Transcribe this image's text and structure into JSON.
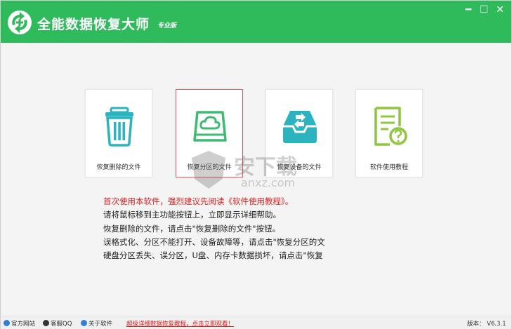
{
  "window": {
    "title": "全能数据恢复大师",
    "edition": "专业版",
    "controls": {
      "minimize": "━",
      "maximize": "☐",
      "close": "✕"
    }
  },
  "cards": [
    {
      "label": "恢复删除的文件",
      "icon": "trash-can-icon",
      "selected": false
    },
    {
      "label": "恢复分区的文件",
      "icon": "drive-cloud-icon",
      "selected": true
    },
    {
      "label": "恢复设备的文件",
      "icon": "inbox-transfer-icon",
      "selected": false
    },
    {
      "label": "软件使用教程",
      "icon": "document-help-icon",
      "selected": false
    }
  ],
  "instructions": [
    "首次使用本软件，强烈建议先阅读《软件使用教程》。",
    "请将鼠标移到主功能按钮上，立即显示详细帮助。",
    "恢复删除的文件，请点击\"恢复删除的文件\"按钮。",
    "误格式化、分区不能打开、设备故障等，请点击\"恢复分区的文",
    "硬盘分区丢失、误分区，U盘、内存卡数据损坏，请点击\"恢复"
  ],
  "watermark": {
    "text": "安下载",
    "sub": "anxz.com"
  },
  "statusbar": {
    "website": "官方网站",
    "qq": "客服QQ",
    "about": "关于软件",
    "promo": "超级详细数据恢复教程，点击立即观看！",
    "version": "版本： V6.3.1"
  },
  "colors": {
    "brand_green": "#2fba5c",
    "accent_teal": "#2bb3c0",
    "icon_green": "#3dbb72",
    "warning_red": "#e02020"
  }
}
